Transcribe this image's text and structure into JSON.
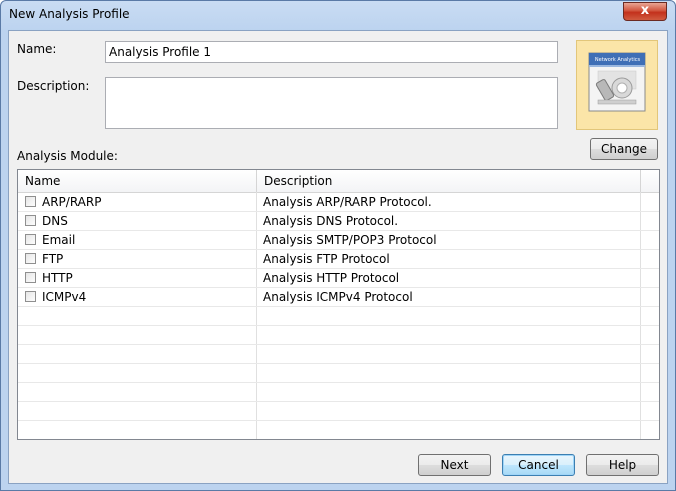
{
  "window": {
    "title": "New Analysis Profile",
    "close_glyph": "x"
  },
  "form": {
    "name_label": "Name:",
    "name_value": "Analysis Profile 1",
    "description_label": "Description:",
    "description_value": "",
    "image_caption": "Network Analytics",
    "change_button": "Change"
  },
  "modules": {
    "label": "Analysis Module:",
    "columns": [
      "Name",
      "Description"
    ],
    "rows": [
      {
        "name": "ARP/RARP",
        "description": "Analysis ARP/RARP Protocol.",
        "checked": false
      },
      {
        "name": "DNS",
        "description": "Analysis DNS Protocol.",
        "checked": false
      },
      {
        "name": "Email",
        "description": "Analysis SMTP/POP3 Protocol",
        "checked": false
      },
      {
        "name": "FTP",
        "description": "Analysis FTP Protocol",
        "checked": false
      },
      {
        "name": "HTTP",
        "description": "Analysis HTTP Protocol",
        "checked": false
      },
      {
        "name": "ICMPv4",
        "description": "Analysis ICMPv4 Protocol",
        "checked": false
      }
    ]
  },
  "buttons": {
    "next": "Next",
    "cancel": "Cancel",
    "help": "Help"
  },
  "colors": {
    "accent": "#3c7fb1",
    "image_bg": "#fbe5a8",
    "close": "#c3311c"
  }
}
